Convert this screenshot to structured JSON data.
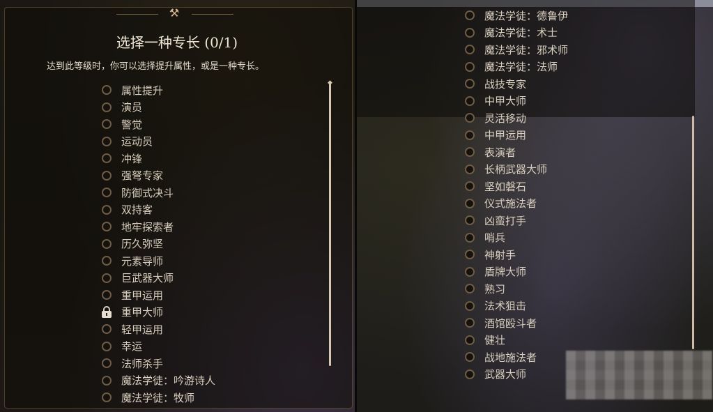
{
  "dialog": {
    "title": "选择一种专长 (0/1)",
    "subtitle": "达到此等级时，你可以选择提升属性，或是一种专长。"
  },
  "left_list": [
    {
      "label": "属性提升",
      "icon": "radio"
    },
    {
      "label": "演员",
      "icon": "radio"
    },
    {
      "label": "警觉",
      "icon": "radio"
    },
    {
      "label": "运动员",
      "icon": "radio"
    },
    {
      "label": "冲锋",
      "icon": "radio"
    },
    {
      "label": "强弩专家",
      "icon": "radio"
    },
    {
      "label": "防御式决斗",
      "icon": "radio"
    },
    {
      "label": "双持客",
      "icon": "radio"
    },
    {
      "label": "地牢探索者",
      "icon": "radio"
    },
    {
      "label": "历久弥坚",
      "icon": "radio"
    },
    {
      "label": "元素导师",
      "icon": "radio"
    },
    {
      "label": "巨武器大师",
      "icon": "radio"
    },
    {
      "label": "重甲运用",
      "icon": "radio"
    },
    {
      "label": "重甲大师",
      "icon": "lock"
    },
    {
      "label": "轻甲运用",
      "icon": "radio"
    },
    {
      "label": "幸运",
      "icon": "radio"
    },
    {
      "label": "法师杀手",
      "icon": "radio"
    },
    {
      "label": "魔法学徒：吟游诗人",
      "icon": "radio"
    },
    {
      "label": "魔法学徒：牧师",
      "icon": "radio"
    }
  ],
  "right_list": [
    {
      "label": "魔法学徒：德鲁伊",
      "icon": "radio"
    },
    {
      "label": "魔法学徒：术士",
      "icon": "radio"
    },
    {
      "label": "魔法学徒：邪术师",
      "icon": "radio"
    },
    {
      "label": "魔法学徒：法师",
      "icon": "radio"
    },
    {
      "label": "战技专家",
      "icon": "radio"
    },
    {
      "label": "中甲大师",
      "icon": "radio"
    },
    {
      "label": "灵活移动",
      "icon": "radio"
    },
    {
      "label": "中甲运用",
      "icon": "radio"
    },
    {
      "label": "表演者",
      "icon": "radio"
    },
    {
      "label": "长柄武器大师",
      "icon": "radio"
    },
    {
      "label": "坚如磐石",
      "icon": "radio"
    },
    {
      "label": "仪式施法者",
      "icon": "radio"
    },
    {
      "label": "凶蛮打手",
      "icon": "radio"
    },
    {
      "label": "哨兵",
      "icon": "radio"
    },
    {
      "label": "神射手",
      "icon": "radio"
    },
    {
      "label": "盾牌大师",
      "icon": "radio"
    },
    {
      "label": "熟习",
      "icon": "radio"
    },
    {
      "label": "法术狙击",
      "icon": "radio"
    },
    {
      "label": "酒馆殴斗者",
      "icon": "radio"
    },
    {
      "label": "健壮",
      "icon": "radio"
    },
    {
      "label": "战地施法者",
      "icon": "radio"
    },
    {
      "label": "武器大师",
      "icon": "radio"
    }
  ]
}
